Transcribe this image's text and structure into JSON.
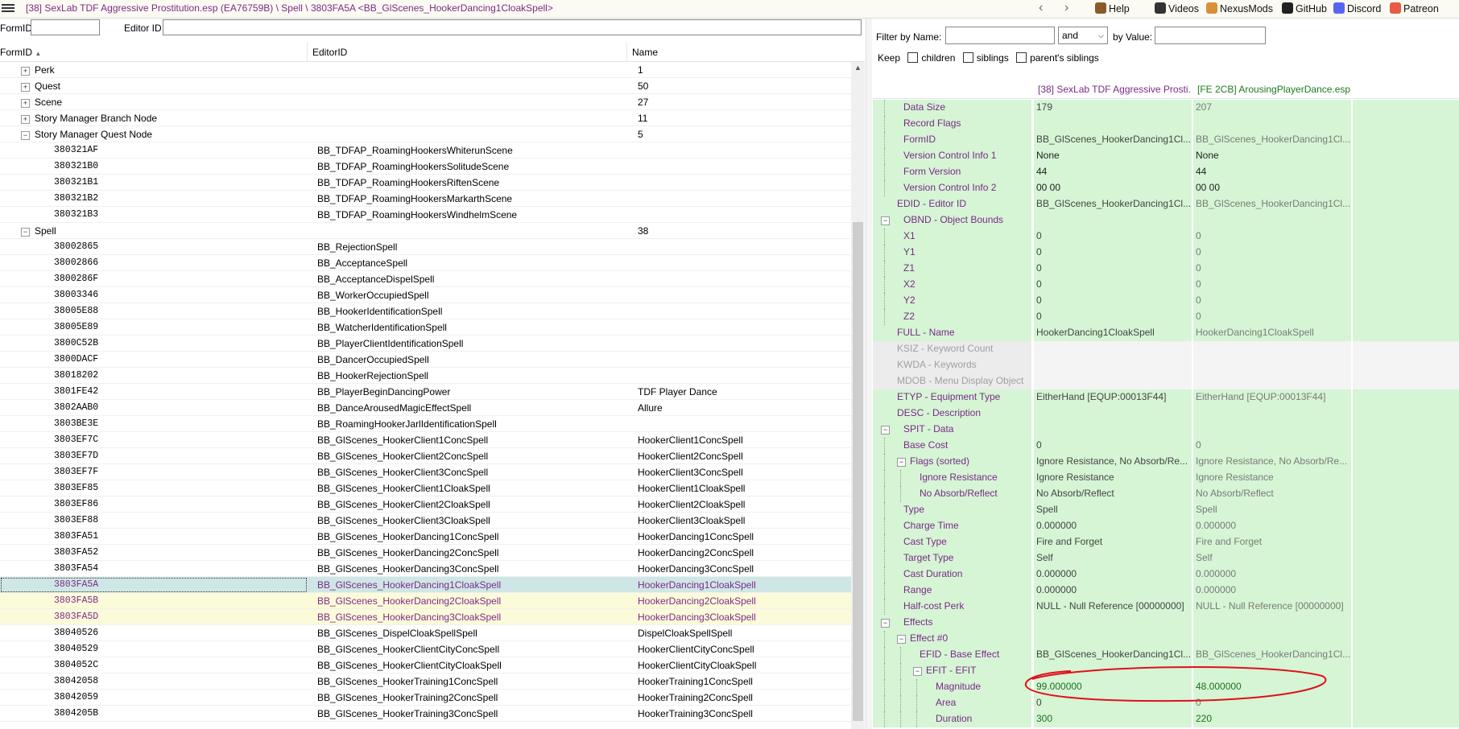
{
  "window": {
    "title": "[38] SexLab TDF Aggressive Prostitution.esp (EA76759B) \\ Spell \\ 3803FA5A <BB_GlScenes_HookerDancing1CloakSpell>"
  },
  "toolbar": {
    "links": [
      {
        "label": "Help",
        "icon": "book-icon",
        "color": "#8b5a2b"
      },
      {
        "label": "Videos",
        "icon": "video-icon",
        "color": "#333333"
      },
      {
        "label": "NexusMods",
        "icon": "nexus-icon",
        "color": "#d98f3a"
      },
      {
        "label": "GitHub",
        "icon": "github-icon",
        "color": "#222222"
      },
      {
        "label": "Discord",
        "icon": "discord-icon",
        "color": "#5865f2"
      },
      {
        "label": "Patreon",
        "icon": "patreon-icon",
        "color": "#e85b46"
      }
    ]
  },
  "search": {
    "formid_label": "FormID",
    "formid_value": "",
    "editorid_label": "Editor ID",
    "editorid_value": ""
  },
  "tree": {
    "columns": [
      "FormID",
      "EditorID",
      "Name"
    ],
    "rows": [
      {
        "type": "group",
        "label": "Perk",
        "count": "1",
        "expanded": false
      },
      {
        "type": "group",
        "label": "Quest",
        "count": "50",
        "expanded": false
      },
      {
        "type": "group",
        "label": "Scene",
        "count": "27",
        "expanded": false
      },
      {
        "type": "group",
        "label": "Story Manager Branch Node",
        "count": "11",
        "expanded": false
      },
      {
        "type": "group",
        "label": "Story Manager Quest Node",
        "count": "5",
        "expanded": true
      },
      {
        "type": "rec",
        "formid": "380321AF",
        "editorid": "BB_TDFAP_RoamingHookersWhiterunScene",
        "name": ""
      },
      {
        "type": "rec",
        "formid": "380321B0",
        "editorid": "BB_TDFAP_RoamingHookersSolitudeScene",
        "name": ""
      },
      {
        "type": "rec",
        "formid": "380321B1",
        "editorid": "BB_TDFAP_RoamingHookersRiftenScene",
        "name": ""
      },
      {
        "type": "rec",
        "formid": "380321B2",
        "editorid": "BB_TDFAP_RoamingHookersMarkarthScene",
        "name": ""
      },
      {
        "type": "rec",
        "formid": "380321B3",
        "editorid": "BB_TDFAP_RoamingHookersWindhelmScene",
        "name": ""
      },
      {
        "type": "group",
        "label": "Spell",
        "count": "38",
        "expanded": true
      },
      {
        "type": "rec",
        "formid": "38002865",
        "editorid": "BB_RejectionSpell",
        "name": ""
      },
      {
        "type": "rec",
        "formid": "38002866",
        "editorid": "BB_AcceptanceSpell",
        "name": ""
      },
      {
        "type": "rec",
        "formid": "3800286F",
        "editorid": "BB_AcceptanceDispelSpell",
        "name": ""
      },
      {
        "type": "rec",
        "formid": "38003346",
        "editorid": "BB_WorkerOccupiedSpell",
        "name": ""
      },
      {
        "type": "rec",
        "formid": "38005E88",
        "editorid": "BB_HookerIdentificationSpell",
        "name": ""
      },
      {
        "type": "rec",
        "formid": "38005E89",
        "editorid": "BB_WatcherIdentificationSpell",
        "name": ""
      },
      {
        "type": "rec",
        "formid": "3800C52B",
        "editorid": "BB_PlayerClientIdentificationSpell",
        "name": ""
      },
      {
        "type": "rec",
        "formid": "3800DACF",
        "editorid": "BB_DancerOccupiedSpell",
        "name": ""
      },
      {
        "type": "rec",
        "formid": "38018202",
        "editorid": "BB_HookerRejectionSpell",
        "name": ""
      },
      {
        "type": "rec",
        "formid": "3801FE42",
        "editorid": "BB_PlayerBeginDancingPower",
        "name": "TDF Player Dance"
      },
      {
        "type": "rec",
        "formid": "3802AAB0",
        "editorid": "BB_DanceArousedMagicEffectSpell",
        "name": "Allure"
      },
      {
        "type": "rec",
        "formid": "3803BE3E",
        "editorid": "BB_RoamingHookerJarlIdentificationSpell",
        "name": ""
      },
      {
        "type": "rec",
        "formid": "3803EF7C",
        "editorid": "BB_GlScenes_HookerClient1ConcSpell",
        "name": "HookerClient1ConcSpell"
      },
      {
        "type": "rec",
        "formid": "3803EF7D",
        "editorid": "BB_GlScenes_HookerClient2ConcSpell",
        "name": "HookerClient2ConcSpell"
      },
      {
        "type": "rec",
        "formid": "3803EF7F",
        "editorid": "BB_GlScenes_HookerClient3ConcSpell",
        "name": "HookerClient3ConcSpell"
      },
      {
        "type": "rec",
        "formid": "3803EF85",
        "editorid": "BB_GlScenes_HookerClient1CloakSpell",
        "name": "HookerClient1CloakSpell"
      },
      {
        "type": "rec",
        "formid": "3803EF86",
        "editorid": "BB_GlScenes_HookerClient2CloakSpell",
        "name": "HookerClient2CloakSpell"
      },
      {
        "type": "rec",
        "formid": "3803EF88",
        "editorid": "BB_GlScenes_HookerClient3CloakSpell",
        "name": "HookerClient3CloakSpell"
      },
      {
        "type": "rec",
        "formid": "3803FA51",
        "editorid": "BB_GlScenes_HookerDancing1ConcSpell",
        "name": "HookerDancing1ConcSpell"
      },
      {
        "type": "rec",
        "formid": "3803FA52",
        "editorid": "BB_GlScenes_HookerDancing2ConcSpell",
        "name": "HookerDancing2ConcSpell"
      },
      {
        "type": "rec",
        "formid": "3803FA54",
        "editorid": "BB_GlScenes_HookerDancing3ConcSpell",
        "name": "HookerDancing3ConcSpell"
      },
      {
        "type": "rec",
        "formid": "3803FA5A",
        "editorid": "BB_GlScenes_HookerDancing1CloakSpell",
        "name": "HookerDancing1CloakSpell",
        "state": "selected"
      },
      {
        "type": "rec",
        "formid": "3803FA5B",
        "editorid": "BB_GlScenes_HookerDancing2CloakSpell",
        "name": "HookerDancing2CloakSpell",
        "state": "highlight"
      },
      {
        "type": "rec",
        "formid": "3803FA5D",
        "editorid": "BB_GlScenes_HookerDancing3CloakSpell",
        "name": "HookerDancing3CloakSpell",
        "state": "highlight"
      },
      {
        "type": "rec",
        "formid": "38040526",
        "editorid": "BB_GlScenes_DispelCloakSpellSpell",
        "name": "DispelCloakSpellSpell"
      },
      {
        "type": "rec",
        "formid": "38040529",
        "editorid": "BB_GlScenes_HookerClientCityConcSpell",
        "name": "HookerClientCityConcSpell"
      },
      {
        "type": "rec",
        "formid": "3804052C",
        "editorid": "BB_GlScenes_HookerClientCityCloakSpell",
        "name": "HookerClientCityCloakSpell"
      },
      {
        "type": "rec",
        "formid": "38042058",
        "editorid": "BB_GlScenes_HookerTraining1ConcSpell",
        "name": "HookerTraining1ConcSpell"
      },
      {
        "type": "rec",
        "formid": "38042059",
        "editorid": "BB_GlScenes_HookerTraining2ConcSpell",
        "name": "HookerTraining2ConcSpell"
      },
      {
        "type": "rec",
        "formid": "3804205B",
        "editorid": "BB_GlScenes_HookerTraining3ConcSpell",
        "name": "HookerTraining3ConcSpell"
      }
    ]
  },
  "filter": {
    "by_name_label": "Filter by Name:",
    "name_value": "",
    "andor_value": "and",
    "by_value_label": "by Value:",
    "value_value": "",
    "keep_label": "Keep",
    "children_label": "children",
    "siblings_label": "siblings",
    "parents_siblings_label": "parent's siblings"
  },
  "view": {
    "columns": [
      "[38] SexLab TDF Aggressive Prosti...",
      "[FE 2CB] ArousingPlayerDance.esp"
    ],
    "rows": [
      {
        "label": "Data Size",
        "indent": 2,
        "v1": "179",
        "v2": "207"
      },
      {
        "label": "Record Flags",
        "indent": 2,
        "v1": "",
        "v2": ""
      },
      {
        "label": "FormID",
        "indent": 2,
        "v1": "BB_GlScenes_HookerDancing1Cl...",
        "v2": "BB_GlScenes_HookerDancing1Cl..."
      },
      {
        "label": "Version Control Info 1",
        "indent": 2,
        "v1": "None",
        "v2": "None",
        "eq": true
      },
      {
        "label": "Form Version",
        "indent": 2,
        "v1": "44",
        "v2": "44",
        "eq": true
      },
      {
        "label": "Version Control Info 2",
        "indent": 2,
        "v1": "00 00",
        "v2": "00 00",
        "eq": true
      },
      {
        "label": "EDID - Editor ID",
        "indent": 1,
        "v1": "BB_GlScenes_HookerDancing1Cl...",
        "v2": "BB_GlScenes_HookerDancing1Cl..."
      },
      {
        "label": "OBND - Object Bounds",
        "indent": 1,
        "exp": "-",
        "v1": "",
        "v2": ""
      },
      {
        "label": "X1",
        "indent": 2,
        "v1": "0",
        "v2": "0"
      },
      {
        "label": "Y1",
        "indent": 2,
        "v1": "0",
        "v2": "0"
      },
      {
        "label": "Z1",
        "indent": 2,
        "v1": "0",
        "v2": "0"
      },
      {
        "label": "X2",
        "indent": 2,
        "v1": "0",
        "v2": "0"
      },
      {
        "label": "Y2",
        "indent": 2,
        "v1": "0",
        "v2": "0"
      },
      {
        "label": "Z2",
        "indent": 2,
        "v1": "0",
        "v2": "0"
      },
      {
        "label": "FULL - Name",
        "indent": 1,
        "v1": "HookerDancing1CloakSpell",
        "v2": "HookerDancing1CloakSpell"
      },
      {
        "label": "KSIZ - Keyword Count",
        "indent": 1,
        "v1": "",
        "v2": "",
        "dim": true
      },
      {
        "label": "KWDA - Keywords",
        "indent": 1,
        "v1": "",
        "v2": "",
        "dim": true
      },
      {
        "label": "MDOB - Menu Display Object",
        "indent": 1,
        "v1": "",
        "v2": "",
        "dim": true
      },
      {
        "label": "ETYP - Equipment Type",
        "indent": 1,
        "v1": "EitherHand [EQUP:00013F44]",
        "v2": "EitherHand [EQUP:00013F44]"
      },
      {
        "label": "DESC - Description",
        "indent": 1,
        "v1": "",
        "v2": ""
      },
      {
        "label": "SPIT - Data",
        "indent": 1,
        "exp": "-",
        "v1": "",
        "v2": ""
      },
      {
        "label": "Base Cost",
        "indent": 2,
        "v1": "0",
        "v2": "0"
      },
      {
        "label": "Flags (sorted)",
        "indent": 2,
        "exp": "-",
        "v1": "Ignore Resistance, No Absorb/Re...",
        "v2": "Ignore Resistance, No Absorb/Re..."
      },
      {
        "label": "Ignore Resistance",
        "indent": 3,
        "v1": "Ignore Resistance",
        "v2": "Ignore Resistance"
      },
      {
        "label": "No Absorb/Reflect",
        "indent": 3,
        "v1": "No Absorb/Reflect",
        "v2": "No Absorb/Reflect"
      },
      {
        "label": "Type",
        "indent": 2,
        "v1": "Spell",
        "v2": "Spell"
      },
      {
        "label": "Charge Time",
        "indent": 2,
        "v1": "0.000000",
        "v2": "0.000000"
      },
      {
        "label": "Cast Type",
        "indent": 2,
        "v1": "Fire and Forget",
        "v2": "Fire and Forget"
      },
      {
        "label": "Target Type",
        "indent": 2,
        "v1": "Self",
        "v2": "Self"
      },
      {
        "label": "Cast Duration",
        "indent": 2,
        "v1": "0.000000",
        "v2": "0.000000"
      },
      {
        "label": "Range",
        "indent": 2,
        "v1": "0.000000",
        "v2": "0.000000"
      },
      {
        "label": "Half-cost Perk",
        "indent": 2,
        "v1": "NULL - Null Reference [00000000]",
        "v2": "NULL - Null Reference [00000000]"
      },
      {
        "label": "Effects",
        "indent": 1,
        "exp": "-",
        "v1": "",
        "v2": ""
      },
      {
        "label": "Effect #0",
        "indent": 2,
        "exp": "-",
        "v1": "",
        "v2": ""
      },
      {
        "label": "EFID - Base Effect",
        "indent": 3,
        "v1": "BB_GlScenes_HookerDancing1Cl...",
        "v2": "BB_GlScenes_HookerDancing1Cl..."
      },
      {
        "label": "EFIT - EFIT",
        "indent": 3,
        "exp": "-",
        "v1": "",
        "v2": ""
      },
      {
        "label": "Magnitude",
        "indent": 4,
        "v1": "99.000000",
        "v2": "48.000000",
        "diff": true
      },
      {
        "label": "Area",
        "indent": 4,
        "v1": "0",
        "v2": "0"
      },
      {
        "label": "Duration",
        "indent": 4,
        "v1": "300",
        "v2": "220",
        "diff": true
      }
    ]
  },
  "colors": {
    "accent_purple": "#7b2a87",
    "match_green": "#d5f5d5",
    "selected_row": "#cfe6e6",
    "highlight_row": "#fcfbd9",
    "annotation_red": "#e0101a"
  }
}
